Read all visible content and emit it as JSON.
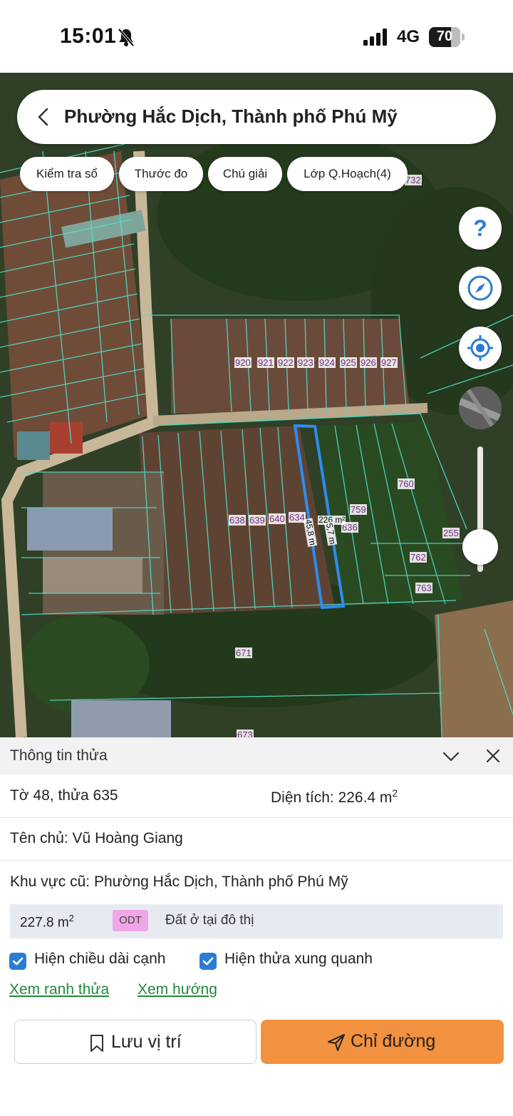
{
  "status_bar": {
    "time": "15:01",
    "network": "4G",
    "battery": "70",
    "battery_level": 0.7
  },
  "header": {
    "title": "Phường Hắc Dịch, Thành phố Phú Mỹ"
  },
  "toolbar": {
    "chips": [
      "Kiểm tra sổ",
      "Thước đo",
      "Chú giải",
      "Lớp Q.Hoạch(4)"
    ]
  },
  "map": {
    "parcel_numbers": [
      "732",
      "920",
      "921",
      "922",
      "923",
      "924",
      "925",
      "926",
      "927",
      "638",
      "639",
      "640",
      "634",
      "636",
      "759",
      "760",
      "255",
      "762",
      "763",
      "671",
      "673"
    ],
    "selected_area_label": "226 m²",
    "edge_length_1": "45,8 m",
    "edge_length_2": "5,7 m",
    "zoom_level": 0.2
  },
  "panel": {
    "title": "Thông tin thửa",
    "sheet_parcel": "Tờ 48, thửa 635",
    "area_label": "Diện tích: 226.4 m",
    "area_sup": "2",
    "owner": "Tên chủ: Vũ Hoàng Giang",
    "old_area": "Khu vực cũ: Phường Hắc Dịch, Thành phố Phú Mỹ",
    "zone": {
      "area": "227.8 m",
      "area_sup": "2",
      "code": "ODT",
      "description": "Đất ở tại đô thị",
      "code_color": "#f0a6e8"
    },
    "checkbox_edges": "Hiện chiều dài cạnh",
    "checkbox_neighbors": "Hiện thửa xung quanh",
    "link_boundary": "Xem ranh thửa",
    "link_direction": "Xem hướng",
    "save_label": "Lưu vị trí",
    "route_label": "Chỉ đường",
    "accent": "#f2913f"
  }
}
